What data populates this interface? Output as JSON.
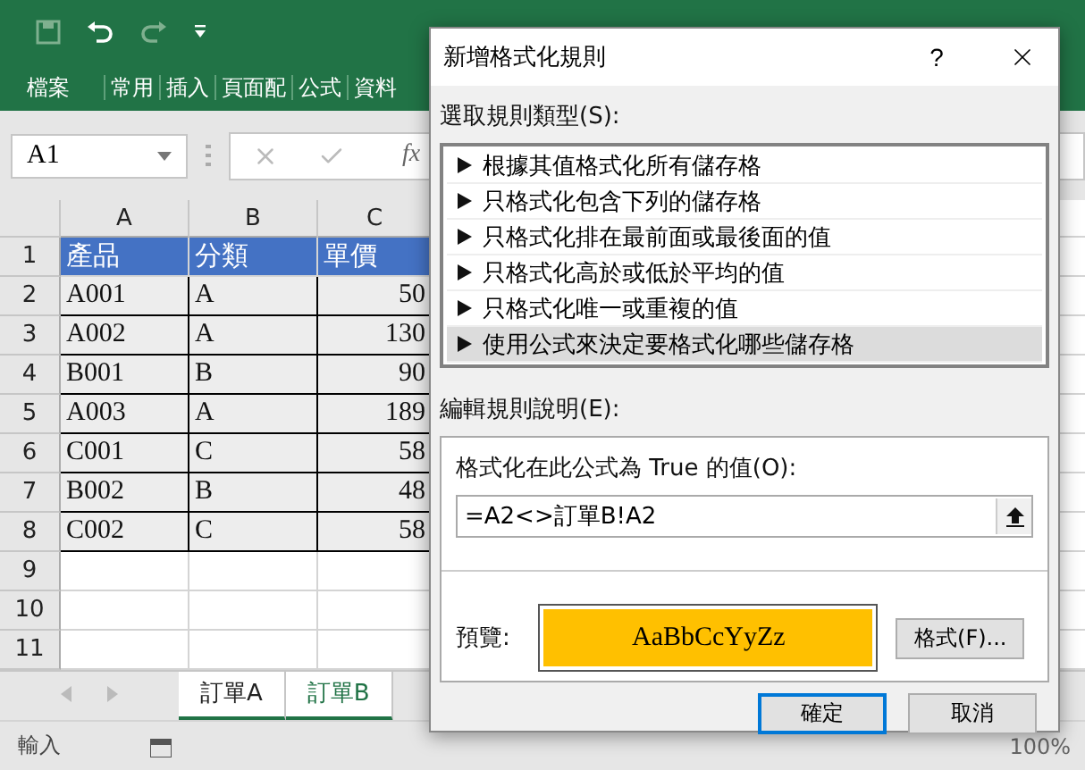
{
  "ribbon_tabs": [
    "檔案",
    "常用",
    "插入",
    "頁面配",
    "公式",
    "資料"
  ],
  "name_box": {
    "value": "A1"
  },
  "function_label": "fx",
  "columns": [
    "A",
    "B",
    "C"
  ],
  "rows": [
    {
      "header": "1",
      "kind": "header",
      "cells": [
        "產品",
        "分類",
        "單價"
      ]
    },
    {
      "header": "2",
      "kind": "data",
      "cells": [
        "A001",
        "A",
        "50"
      ]
    },
    {
      "header": "3",
      "kind": "data",
      "cells": [
        "A002",
        "A",
        "130"
      ]
    },
    {
      "header": "4",
      "kind": "data",
      "cells": [
        "B001",
        "B",
        "90"
      ]
    },
    {
      "header": "5",
      "kind": "data",
      "cells": [
        "A003",
        "A",
        "189"
      ]
    },
    {
      "header": "6",
      "kind": "data",
      "cells": [
        "C001",
        "C",
        "58"
      ]
    },
    {
      "header": "7",
      "kind": "data",
      "cells": [
        "B002",
        "B",
        "48"
      ]
    },
    {
      "header": "8",
      "kind": "data",
      "cells": [
        "C002",
        "C",
        "58"
      ]
    },
    {
      "header": "9",
      "kind": "empty"
    },
    {
      "header": "10",
      "kind": "empty"
    },
    {
      "header": "11",
      "kind": "empty"
    }
  ],
  "sheet_tabs": [
    {
      "label": "訂單A",
      "selected": false
    },
    {
      "label": "訂單B",
      "selected": true
    }
  ],
  "status_bar": {
    "mode": "輸入",
    "zoom": "100%"
  },
  "dialog": {
    "title": "新增格式化規則",
    "help": "?",
    "rule_type_label": "選取規則類型(S):",
    "rule_types": [
      {
        "label": "根據其值格式化所有儲存格",
        "selected": false
      },
      {
        "label": "只格式化包含下列的儲存格",
        "selected": false
      },
      {
        "label": "只格式化排在最前面或最後面的值",
        "selected": false
      },
      {
        "label": "只格式化高於或低於平均的值",
        "selected": false
      },
      {
        "label": "只格式化唯一或重複的值",
        "selected": false
      },
      {
        "label": "使用公式來決定要格式化哪些儲存格",
        "selected": true
      }
    ],
    "description_label": "編輯規則說明(E):",
    "formula_label": "格式化在此公式為 True 的值(O):",
    "formula": "=A2<>訂單B!A2",
    "preview_label": "預覽:",
    "preview_text": "AaBbCcYyZz",
    "format_button": "格式(F)...",
    "buttons": [
      {
        "label": "確定",
        "kind": "default"
      },
      {
        "label": "取消",
        "kind": "normal"
      }
    ]
  }
}
